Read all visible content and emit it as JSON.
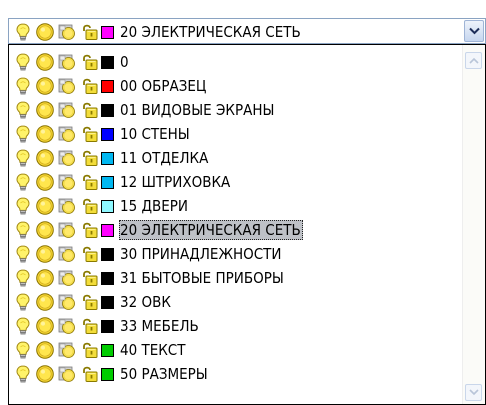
{
  "combo": {
    "selected_label": "20 ЭЛЕКТРИЧЕСКАЯ СЕТЬ",
    "selected_color": "#ff00ff"
  },
  "layers": [
    {
      "label": "0",
      "color": "#000000"
    },
    {
      "label": "00 ОБРАЗЕЦ",
      "color": "#ff0000"
    },
    {
      "label": "01 ВИДОВЫЕ ЭКРАНЫ",
      "color": "#000000"
    },
    {
      "label": "10 СТЕНЫ",
      "color": "#0000ff"
    },
    {
      "label": "11 ОТДЕЛКА",
      "color": "#00b7f0"
    },
    {
      "label": "12 ШТРИХОВКА",
      "color": "#00b7f0"
    },
    {
      "label": "15 ДВЕРИ",
      "color": "#8ef8ff"
    },
    {
      "label": "20 ЭЛЕКТРИЧЕСКАЯ СЕТЬ",
      "color": "#ff00ff",
      "selected": true
    },
    {
      "label": "30 ПРИНАДЛЕЖНОСТИ",
      "color": "#000000"
    },
    {
      "label": "31 БЫТОВЫЕ ПРИБОРЫ",
      "color": "#000000"
    },
    {
      "label": "32 ОВК",
      "color": "#000000"
    },
    {
      "label": "33 МЕБЕЛЬ",
      "color": "#000000"
    },
    {
      "label": "40 ТЕКСТ",
      "color": "#00cc00"
    },
    {
      "label": "50 РАЗМЕРЫ",
      "color": "#00cc00"
    }
  ],
  "icons": {
    "on_off": "lightbulb-icon",
    "freeze": "sun-icon",
    "viewport_freeze": "viewport-sun-icon",
    "lock": "padlock-icon"
  }
}
